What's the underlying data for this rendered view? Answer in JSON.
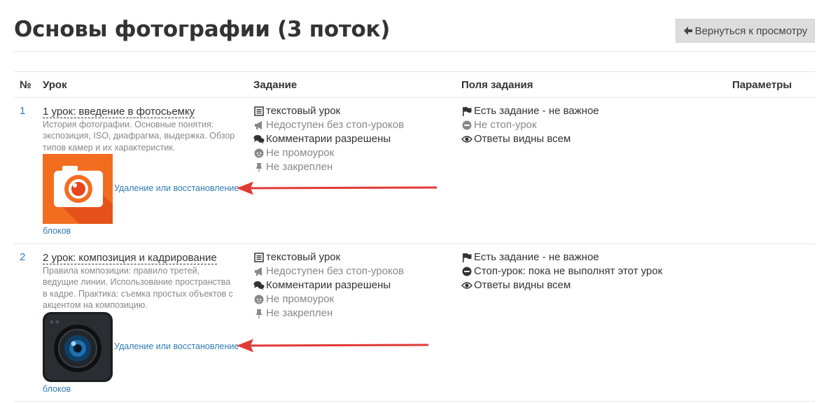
{
  "header": {
    "title": "Основы фотографии (3 поток)",
    "back_label": "Вернуться к просмотру"
  },
  "table": {
    "columns": [
      "№",
      "Урок",
      "Задание",
      "Поля задания",
      "Параметры"
    ],
    "rows": [
      {
        "num": "1",
        "title": "1 урок: введение в фотосьемку",
        "description": "История фотографии. Основные понятия: экспозиция, ISO, диафрагма, выдержка. Обзор типов камер и их характеристик.",
        "image": "orange-camera-icon",
        "delete_link": "Удаление или восстановление",
        "blocks_link": "блоков",
        "task": [
          {
            "icon": "list-icon",
            "text": "текстовый урок"
          },
          {
            "icon": "bullhorn-icon",
            "text": "Недоступен без стоп-уроков"
          },
          {
            "icon": "comments-icon",
            "text": "Комментарии разрешены"
          },
          {
            "icon": "reddit-icon",
            "text": "Не промоурок"
          },
          {
            "icon": "pin-icon",
            "text": "Не закреплен"
          }
        ],
        "fields": [
          {
            "icon": "flag-icon",
            "text": "Есть задание - не важное"
          },
          {
            "icon": "minus-circle-icon",
            "text": "Не стоп-урок"
          },
          {
            "icon": "eye-icon",
            "text": "Ответы видны всем"
          }
        ]
      },
      {
        "num": "2",
        "title": "2 урок: композиция и кадрирование",
        "description": "Правила композиции: правило третей, ведущие линии. Использование пространства в кадре. Практика: съемка простых объектов с акцентом на композицию.",
        "image": "dark-lens-icon",
        "delete_link": "Удаление или восстановление",
        "blocks_link": "блоков",
        "task": [
          {
            "icon": "list-icon",
            "text": "текстовый урок"
          },
          {
            "icon": "bullhorn-icon",
            "text": "Недоступен без стоп-уроков"
          },
          {
            "icon": "comments-icon",
            "text": "Комментарии разрешены"
          },
          {
            "icon": "reddit-icon",
            "text": "Не промоурок"
          },
          {
            "icon": "pin-icon",
            "text": "Не закреплен"
          }
        ],
        "fields": [
          {
            "icon": "flag-icon",
            "text": "Есть задание - не важное"
          },
          {
            "icon": "minus-circle-icon",
            "text": "Стоп-урок: пока не выполнят этот урок"
          },
          {
            "icon": "eye-icon",
            "text": "Ответы видны всем"
          }
        ]
      }
    ]
  },
  "colors": {
    "link": "#337ab7",
    "annotation_arrow": "#e03a36",
    "orange": "#f36d21"
  }
}
